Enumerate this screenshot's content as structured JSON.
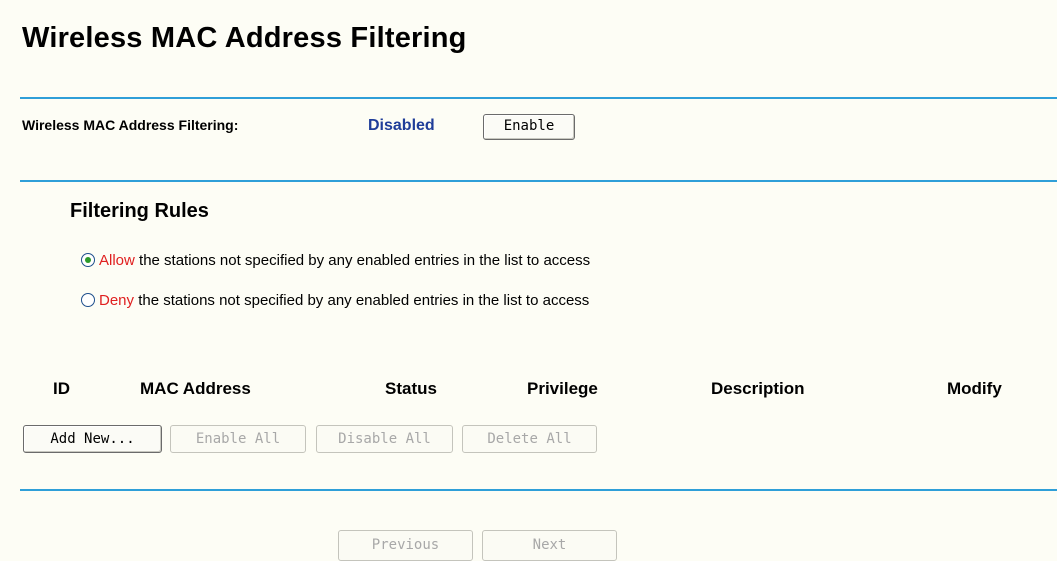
{
  "page": {
    "title": "Wireless MAC Address Filtering"
  },
  "status": {
    "label": "Wireless MAC Address Filtering:",
    "value": "Disabled",
    "button_label": "Enable"
  },
  "rules": {
    "title": "Filtering Rules",
    "options": [
      {
        "keyword": "Allow",
        "text": " the stations not specified by any enabled entries in the list to access",
        "checked": true
      },
      {
        "keyword": "Deny",
        "text": " the stations not specified by any enabled entries in the list to access",
        "checked": false
      }
    ]
  },
  "table": {
    "headers": [
      "ID",
      "MAC Address",
      "Status",
      "Privilege",
      "Description",
      "Modify"
    ]
  },
  "actions": {
    "add_new": "Add New...",
    "enable_all": "Enable All",
    "disable_all": "Disable All",
    "delete_all": "Delete All"
  },
  "pagination": {
    "previous": "Previous",
    "next": "Next"
  },
  "colors": {
    "divider": "#2f9fd8",
    "status_value": "#1f3d99",
    "keyword": "#e02020",
    "background": "#fdfdf5"
  }
}
